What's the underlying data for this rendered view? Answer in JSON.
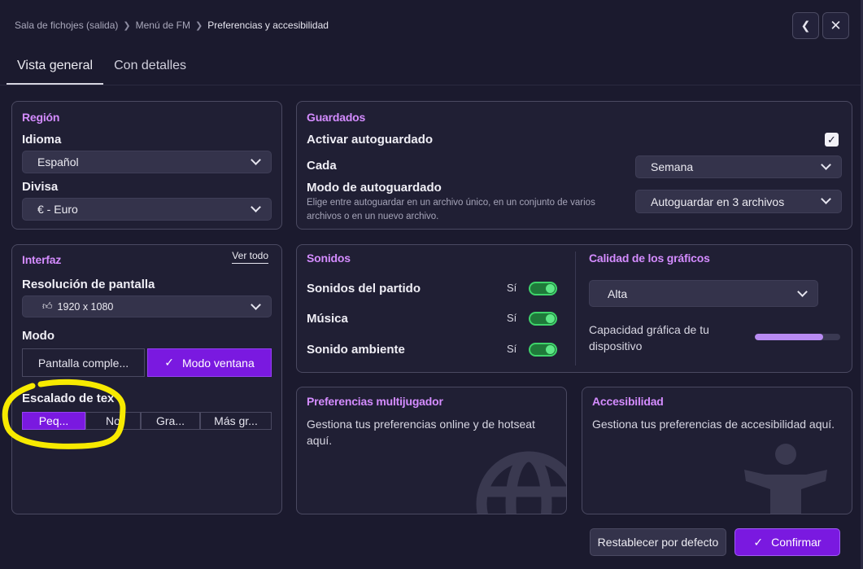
{
  "breadcrumb": {
    "items": [
      "Sala de fichojes (salida)",
      "Menú de FM"
    ],
    "current": "Preferencias y accesibilidad"
  },
  "nav": {
    "back_icon": "chevron-left-icon",
    "close_icon": "close-icon"
  },
  "tabs": [
    {
      "label": "Vista general",
      "active": true
    },
    {
      "label": "Con detalles",
      "active": false
    }
  ],
  "region": {
    "title": "Región",
    "language_label": "Idioma",
    "language_value": "Español",
    "currency_label": "Divisa",
    "currency_value": "€ - Euro"
  },
  "saves": {
    "title": "Guardados",
    "autosave_label": "Activar autoguardado",
    "autosave_checked": true,
    "every_label": "Cada",
    "every_value": "Semana",
    "mode_label": "Modo de autoguardado",
    "mode_description": "Elige entre autoguardar en un archivo único, en un conjunto de varios archivos o en un nuevo archivo.",
    "mode_value": "Autoguardar en 3 archivos"
  },
  "interface": {
    "title": "Interfaz",
    "see_all": "Ver todo",
    "resolution_label": "Resolución de pantalla",
    "resolution_value": "1920 x 1080",
    "mode_label": "Modo",
    "mode_options": [
      {
        "label": "Pantalla comple...",
        "selected": false
      },
      {
        "label": "Modo ventana",
        "selected": true
      }
    ],
    "text_scale_label": "Escalado de tex",
    "text_scale_options": [
      {
        "label": "Peq...",
        "selected": true
      },
      {
        "label": "No",
        "selected": false
      },
      {
        "label": "Gra...",
        "selected": false
      },
      {
        "label": "Más gr...",
        "selected": false
      }
    ],
    "annotation_color": "#f7ea00"
  },
  "sounds": {
    "title": "Sonidos",
    "items": [
      {
        "label": "Sonidos del partido",
        "state": "Sí",
        "on": true
      },
      {
        "label": "Música",
        "state": "Sí",
        "on": true
      },
      {
        "label": "Sonido ambiente",
        "state": "Sí",
        "on": true
      }
    ]
  },
  "graphics": {
    "title": "Calidad de los gráficos",
    "quality_value": "Alta",
    "capacity_label": "Capacidad gráfica de tu dispositivo",
    "capacity_fraction": 0.8
  },
  "multiplayer": {
    "title": "Preferencias multijugador",
    "description": "Gestiona tus preferencias online y de hotseat aquí.",
    "icon": "globe-icon"
  },
  "accessibility": {
    "title": "Accesibilidad",
    "description": "Gestiona tus preferencias de accesibilidad aquí.",
    "icon": "accessibility-person-icon"
  },
  "footer": {
    "reset_label": "Restablecer por defecto",
    "confirm_label": "Confirmar"
  },
  "colors": {
    "background": "#1b1a2e",
    "accent": "#7a19e0",
    "title_pink": "#d48cff",
    "toggle_green": "#3ed36a"
  }
}
